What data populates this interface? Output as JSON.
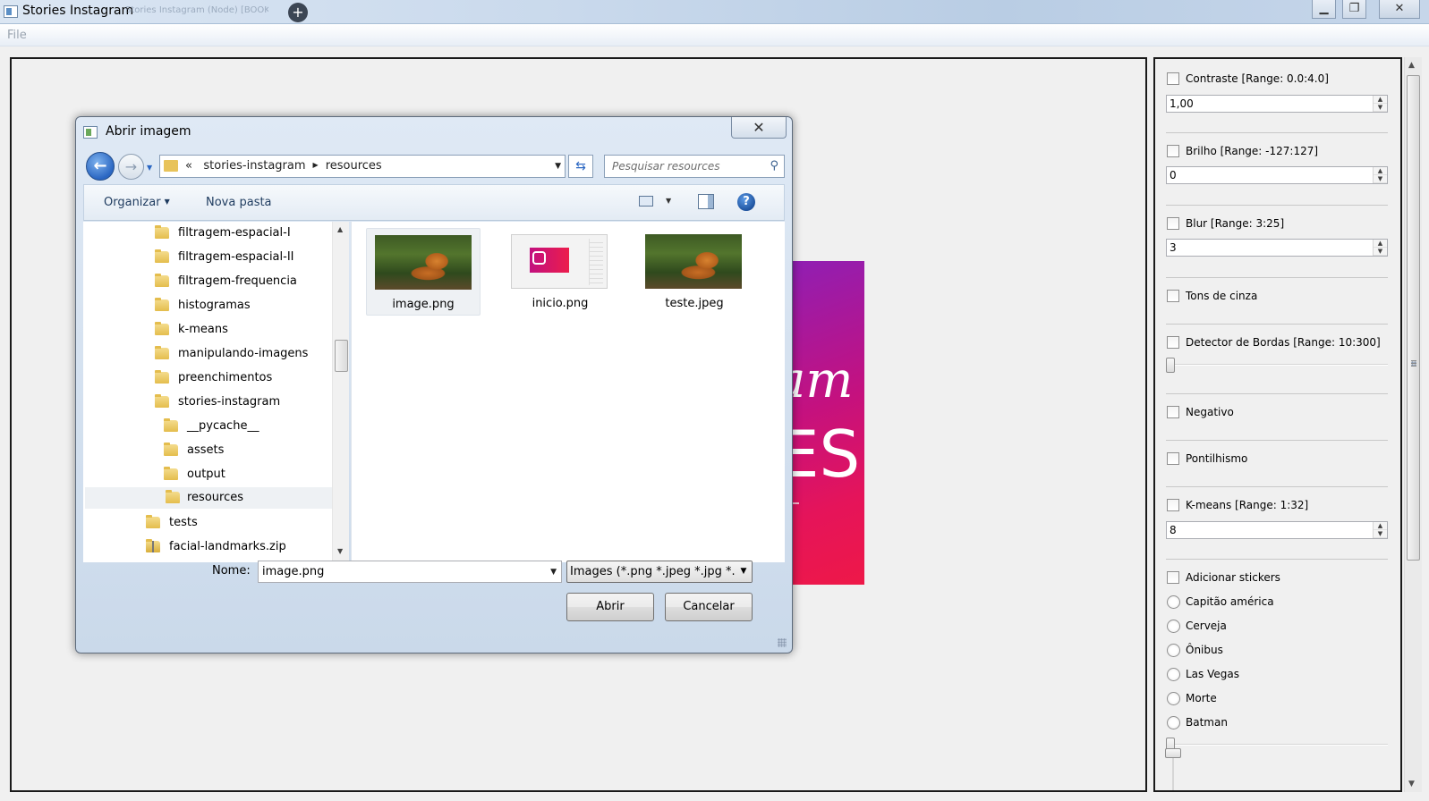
{
  "window": {
    "title": "Stories Instagram",
    "background_tab": "Stories Instagram (Node) [BOOK]",
    "minimize_glyph": "▁",
    "restore_glyph": "❐",
    "close_glyph": "✕"
  },
  "menu": {
    "file": "File"
  },
  "canvas": {
    "image_text_1": "am",
    "image_text_2": "ES"
  },
  "panel": {
    "contraste": {
      "label": "Contraste [Range: 0.0:4.0]",
      "checked": false,
      "value": "1,00"
    },
    "brilho": {
      "label": "Brilho [Range: -127:127]",
      "checked": false,
      "value": "0"
    },
    "blur": {
      "label": "Blur [Range: 3:25]",
      "checked": false,
      "value": "3"
    },
    "tons_de_cinza": {
      "label": "Tons de cinza",
      "checked": false
    },
    "detector_de_bordas": {
      "label": "Detector de Bordas [Range: 10:300]",
      "checked": false,
      "slider_value": 10
    },
    "negativo": {
      "label": "Negativo",
      "checked": false
    },
    "pontilhismo": {
      "label": "Pontilhismo",
      "checked": false
    },
    "kmeans": {
      "label": "K-means [Range: 1:32]",
      "checked": false,
      "value": "8"
    },
    "stickers": {
      "label": "Adicionar stickers",
      "checked": false,
      "options": [
        "Capitão américa",
        "Cerveja",
        "Ônibus",
        "Las Vegas",
        "Morte",
        "Batman"
      ]
    },
    "spin_up": "▲",
    "spin_down": "▼"
  },
  "dialog": {
    "title": "Abrir imagem",
    "close_glyph": "✕",
    "back_glyph": "←",
    "forward_glyph": "→",
    "address": {
      "prefix": "«",
      "segments": [
        "stories-instagram",
        "resources"
      ]
    },
    "refresh_glyph": "⇆",
    "search_placeholder": "Pesquisar resources",
    "search_glyph": "⚲",
    "toolbar": {
      "organize": "Organizar",
      "new_folder": "Nova pasta",
      "help": "?"
    },
    "tree": [
      {
        "label": "filtragem-espacial-I",
        "indent": 1,
        "selected": false
      },
      {
        "label": "filtragem-espacial-II",
        "indent": 1,
        "selected": false
      },
      {
        "label": "filtragem-frequencia",
        "indent": 1,
        "selected": false
      },
      {
        "label": "histogramas",
        "indent": 1,
        "selected": false
      },
      {
        "label": "k-means",
        "indent": 1,
        "selected": false
      },
      {
        "label": "manipulando-imagens",
        "indent": 1,
        "selected": false
      },
      {
        "label": "preenchimentos",
        "indent": 1,
        "selected": false
      },
      {
        "label": "stories-instagram",
        "indent": 1,
        "selected": false
      },
      {
        "label": "__pycache__",
        "indent": 2,
        "selected": false
      },
      {
        "label": "assets",
        "indent": 2,
        "selected": false
      },
      {
        "label": "output",
        "indent": 2,
        "selected": false
      },
      {
        "label": "resources",
        "indent": 2,
        "selected": true
      },
      {
        "label": "tests",
        "indent": 0,
        "selected": false
      },
      {
        "label": "facial-landmarks.zip",
        "indent": 0,
        "selected": false
      }
    ],
    "files": [
      {
        "name": "image.png",
        "thumb": "tiger",
        "selected": true
      },
      {
        "name": "inicio.png",
        "thumb": "instagram",
        "selected": false
      },
      {
        "name": "teste.jpeg",
        "thumb": "tiger",
        "selected": false
      }
    ],
    "name_label": "Nome:",
    "name_value": "image.png",
    "filter_value": "Images (*.png *.jpeg *.jpg *.",
    "open_button": "Abrir",
    "cancel_button": "Cancelar",
    "dropdown_glyph": "▼",
    "scroll_up": "▲",
    "scroll_down": "▼"
  },
  "colors": {
    "accent": "#2a66c2",
    "story_gradient_start": "#8e1fb5",
    "story_gradient_end": "#ee1848"
  }
}
